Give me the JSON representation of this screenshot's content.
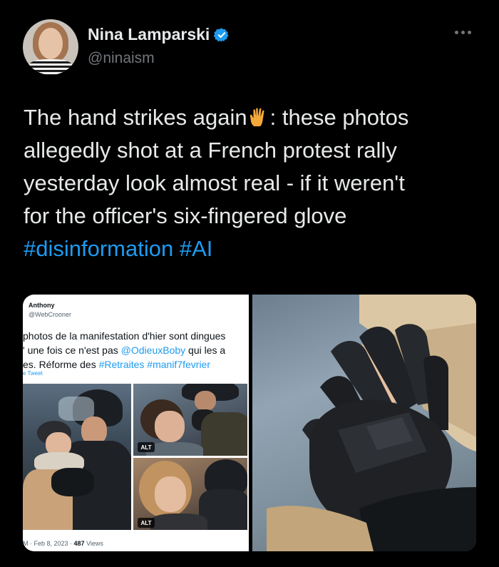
{
  "author": {
    "display_name": "Nina Lamparski",
    "handle": "@ninaism",
    "verified": true,
    "avatar_icon": "avatar-photo"
  },
  "more_icon": "more-horizontal-icon",
  "tweet": {
    "line1_before_emoji": "The hand strikes again",
    "emoji": "vulcan-salute-hand",
    "line1_after_emoji": ": these photos",
    "line2": "allegedly shot at a French protest rally",
    "line3": "yesterday look almost real - if it weren't",
    "line4": "for the officer's six-fingered glove",
    "hashtags": [
      "#disinformation",
      "#AI"
    ]
  },
  "embedded_tweet": {
    "author": "Anthony",
    "handle": "@WebCrooner",
    "line1": "photos de la manifestation d'hier sont dingues",
    "line2_before": "' une fois ce n'est pas ",
    "line2_mention": "@OdieuxBoby",
    "line2_after": " qui les a",
    "line3_before": "es. Réforme des ",
    "line3_tags": "#Retraites #manif7fevrier",
    "translate": "e Tweet",
    "alt_label": "ALT",
    "footer_prefix": "M · Feb 8, 2023 · ",
    "views_count": "487",
    "views_label": " Views"
  },
  "colors": {
    "background": "#000000",
    "text": "#e7e9ea",
    "secondary": "#71767b",
    "link": "#1d9bf0"
  }
}
